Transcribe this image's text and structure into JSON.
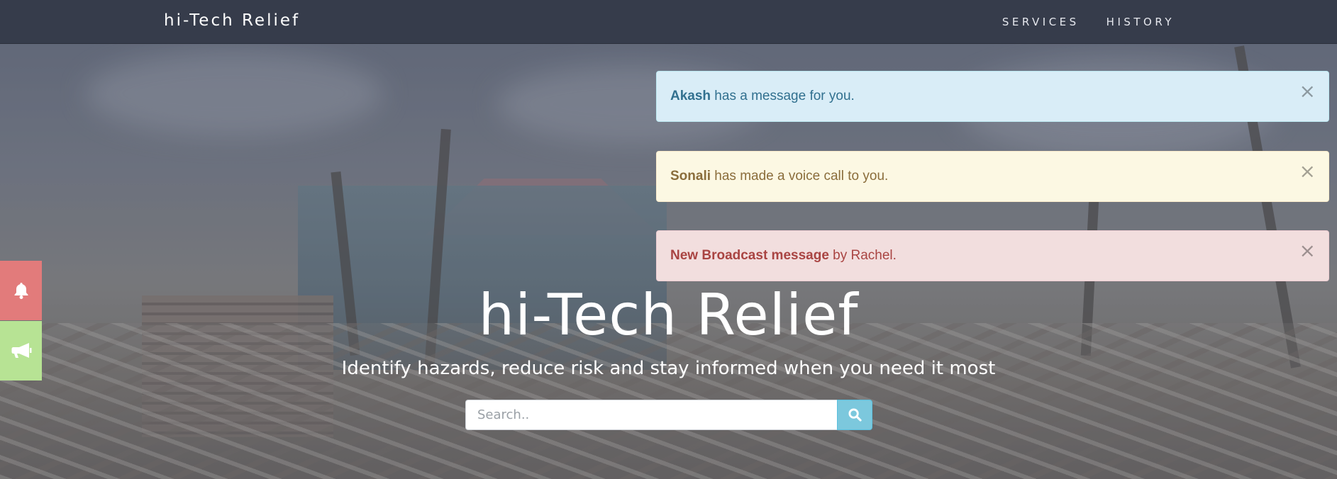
{
  "navbar": {
    "brand": "hi-Tech Relief",
    "links": [
      "SERVICES",
      "HISTORY"
    ]
  },
  "alerts": [
    {
      "type": "info",
      "strong": "Akash",
      "text": " has a message for you.",
      "close": "×"
    },
    {
      "type": "warning",
      "strong": "Sonali",
      "text": " has made a voice call to you.",
      "close": "×"
    },
    {
      "type": "danger",
      "strong": "New Broadcast message",
      "text": " by Rachel.",
      "close": "×"
    }
  ],
  "side_buttons": [
    {
      "icon": "bell-icon",
      "color": "#e27b7b"
    },
    {
      "icon": "megaphone-icon",
      "color": "#b7e394"
    }
  ],
  "hero": {
    "title": "hi-Tech Relief",
    "subtitle": "Identify hazards, reduce risk and stay informed when you need it most"
  },
  "search": {
    "placeholder": "Search..",
    "button_icon": "search-icon"
  },
  "colors": {
    "navbar_bg": "#363c4b",
    "info_bg": "#d9edf7",
    "warning_bg": "#fcf8e3",
    "danger_bg": "#f2dede",
    "search_button": "#7cc8dd"
  }
}
